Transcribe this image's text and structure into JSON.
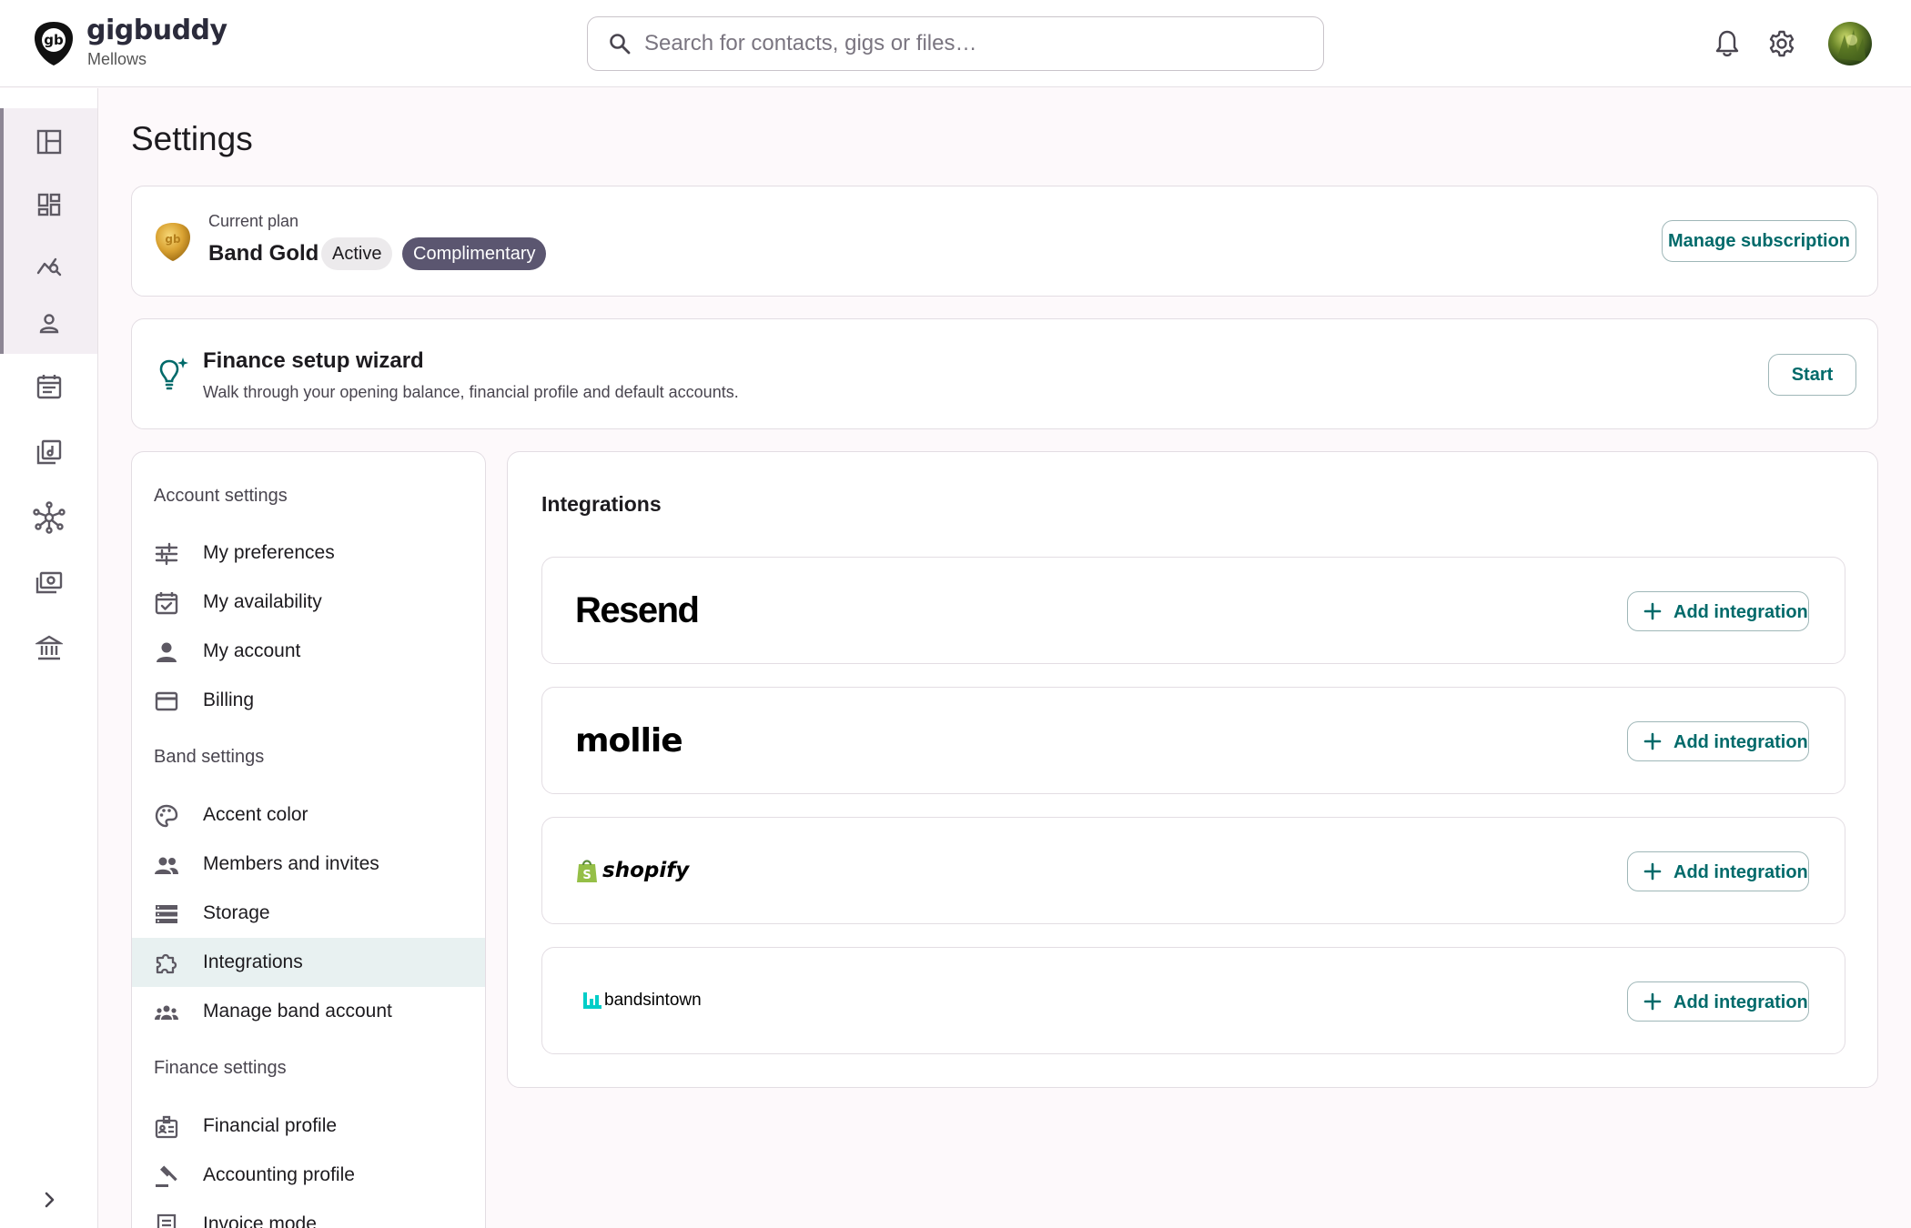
{
  "header": {
    "brand": "gigbuddy",
    "band": "Mellows",
    "search_placeholder": "Search for contacts, gigs or files…",
    "icons": [
      "bell-icon",
      "gear-icon",
      "avatar"
    ]
  },
  "rail": {
    "items": [
      "dashboard-icon",
      "widgets-icon",
      "analytics-icon",
      "person-icon",
      "calendar-icon",
      "music-library-icon",
      "network-icon",
      "money-icon",
      "bank-icon"
    ],
    "expand_icon": "chevron-right-icon"
  },
  "page": {
    "title": "Settings"
  },
  "plan": {
    "label": "Current plan",
    "name": "Band Gold",
    "status": "Active",
    "tier_badge": "Complimentary",
    "manage_label": "Manage subscription"
  },
  "wizard": {
    "title": "Finance setup wizard",
    "description": "Walk through your opening balance, financial profile and default accounts.",
    "start_label": "Start"
  },
  "settings_nav": {
    "account_heading": "Account settings",
    "account_items": [
      "My preferences",
      "My availability",
      "My account",
      "Billing"
    ],
    "band_heading": "Band settings",
    "band_items": [
      "Accent color",
      "Members and invites",
      "Storage",
      "Integrations",
      "Manage band account"
    ],
    "finance_heading": "Finance settings",
    "finance_items": [
      "Financial profile",
      "Accounting profile",
      "Invoice mode"
    ],
    "selected": "Integrations"
  },
  "integrations": {
    "title": "Integrations",
    "items": [
      {
        "name": "Resend",
        "action": "Add integration"
      },
      {
        "name": "mollie",
        "action": "Add integration"
      },
      {
        "name": "shopify",
        "action": "Add integration"
      },
      {
        "name": "bandsintown",
        "action": "Add integration"
      }
    ]
  },
  "colors": {
    "accent": "#006a6a",
    "chip_complimentary": "#5b5670",
    "selected_nav": "#e8f1f1",
    "background": "#fdf9fb",
    "bandsintown_brand": "#00cec8",
    "shopify_brand": "#95bf47"
  }
}
